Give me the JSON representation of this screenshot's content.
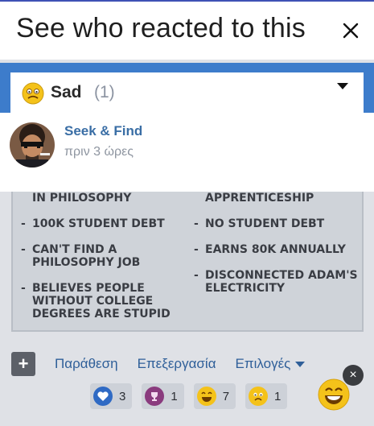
{
  "modal": {
    "title": "See who reacted to this",
    "close_label": "×"
  },
  "filter": {
    "reaction_label": "Sad",
    "reaction_count": "(1)"
  },
  "reactors": [
    {
      "name": "Seek & Find",
      "time": "πριν 3 ώρες"
    }
  ],
  "meme": {
    "left": [
      "IN PHILOSOPHY",
      "100K STUDENT DEBT",
      "CAN'T FIND A PHILOSOPHY JOB",
      "BELIEVES PEOPLE WITHOUT COLLEGE DEGREES ARE STUPID"
    ],
    "right": [
      "APPRENTICESHIP",
      "NO STUDENT DEBT",
      "EARNS 80K ANNUALLY",
      "DISCONNECTED ADAM'S ELECTRICITY"
    ]
  },
  "post_actions": {
    "plus": "+",
    "quote": "Παράθεση",
    "edit": "Επεξεργασία",
    "options": "Επιλογές"
  },
  "reaction_counts": [
    {
      "icon": "heart-icon",
      "count": "3"
    },
    {
      "icon": "trophy-icon",
      "count": "1"
    },
    {
      "icon": "laugh-icon",
      "count": "7"
    },
    {
      "icon": "sad-icon",
      "count": "1"
    }
  ],
  "floating": {
    "close": "×"
  },
  "colors": {
    "accent_blue": "#3d7ccb",
    "link_blue": "#3a6ea5",
    "header_border": "#3f51b5"
  }
}
